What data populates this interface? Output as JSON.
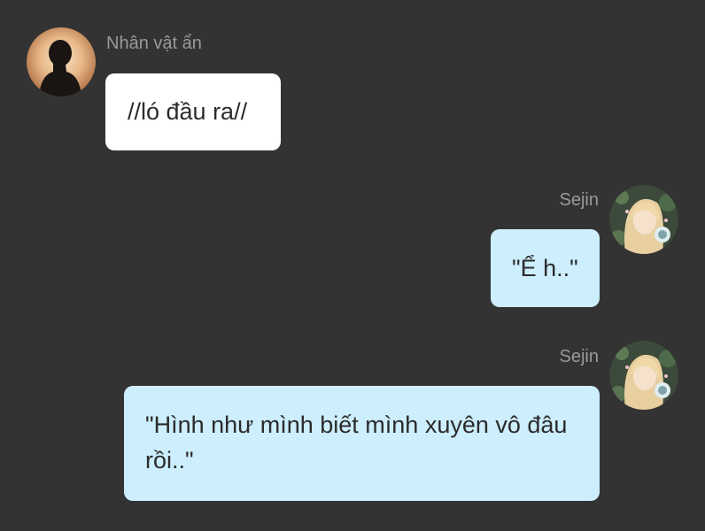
{
  "messages": [
    {
      "side": "left",
      "sender": "Nhân vật ẩn",
      "avatar_icon": "silhouette-avatar-icon",
      "text": "//ló đầu ra//"
    },
    {
      "side": "right",
      "sender": "Sejin",
      "avatar_icon": "character-portrait-avatar-icon",
      "text": "\"Ể h..\""
    },
    {
      "side": "right",
      "sender": "Sejin",
      "avatar_icon": "character-portrait-avatar-icon",
      "text": "\"Hình như mình biết mình xuyên vô đâu rồi..\""
    }
  ],
  "colors": {
    "background": "#333333",
    "left_bubble": "#ffffff",
    "right_bubble": "#cdeefd",
    "sender_name": "#9a9a9a",
    "message_text": "#2b2b2b"
  }
}
